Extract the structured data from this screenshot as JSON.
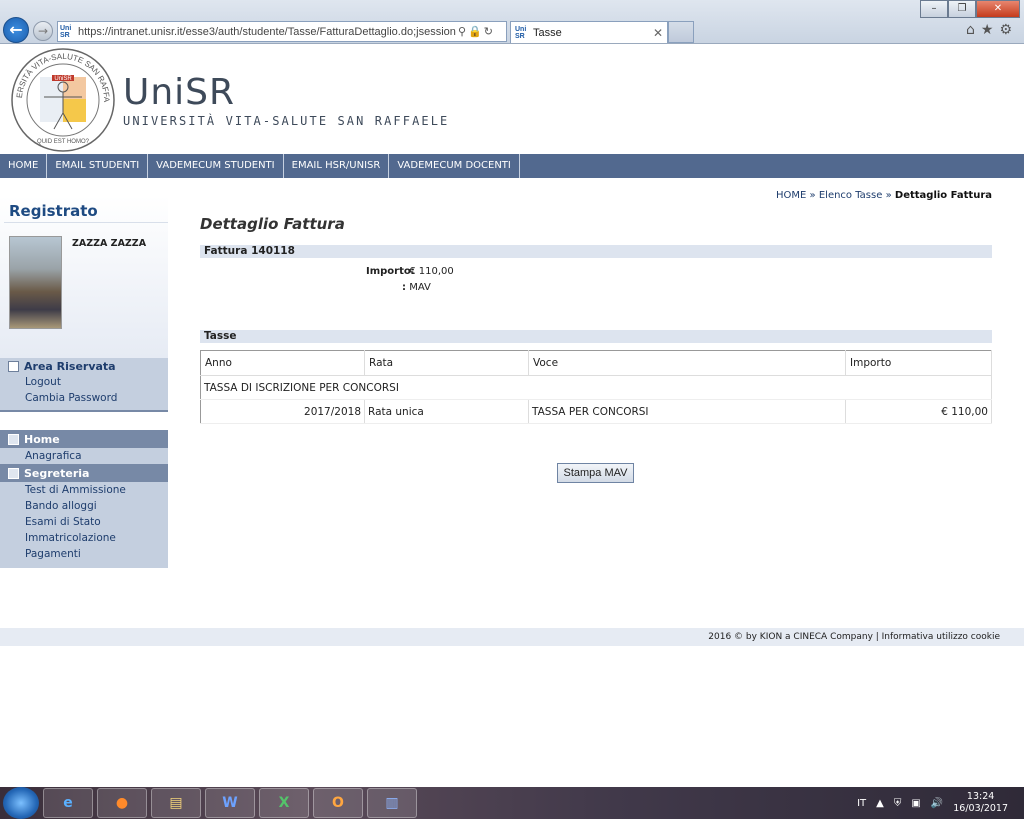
{
  "browser": {
    "url": "https://intranet.unisr.it/esse3/auth/studente/Tasse/FatturaDettaglio.do;jsessionid=12EB9",
    "tab_title": "Tasse"
  },
  "brand": {
    "name": "UniSR",
    "subtitle": "UNIVERSITÀ VITA-SALUTE SAN RAFFAELE",
    "seal_top": "UNIVERSITÀ VITA-SALUTE SAN RAFFAELE",
    "seal_center": "UniSR",
    "seal_bottom": "QUID EST HOMO?"
  },
  "topnav": [
    "HOME",
    "EMAIL STUDENTI",
    "VADEMECUM STUDENTI",
    "EMAIL HSR/UNISR",
    "VADEMECUM DOCENTI"
  ],
  "sidebar": {
    "heading": "Registrato",
    "username": "ZAZZA ZAZZA",
    "area_riservata": {
      "label": "Area Riservata",
      "items": [
        "Logout",
        "Cambia Password"
      ]
    },
    "home": {
      "label": "Home",
      "items": [
        "Anagrafica"
      ]
    },
    "segreteria": {
      "label": "Segreteria",
      "items": [
        "Test di Ammissione",
        "Bando alloggi",
        "Esami di Stato",
        "Immatricolazione",
        "Pagamenti"
      ]
    }
  },
  "breadcrumb": {
    "home": "HOME",
    "sep": "»",
    "elenco": "Elenco Tasse",
    "current": "Dettaglio Fattura"
  },
  "page_title": "Dettaglio Fattura",
  "fattura": {
    "bar_label": "Fattura 140118",
    "importo_label": "Importo:",
    "importo_value": "€ 110,00",
    "second_label": ":",
    "second_value": "MAV"
  },
  "tasse": {
    "bar_label": "Tasse",
    "columns": [
      "Anno",
      "Rata",
      "Voce",
      "Importo"
    ],
    "group": "TASSA DI ISCRIZIONE PER CONCORSI",
    "row": {
      "anno": "2017/2018",
      "rata": "Rata unica",
      "voce": "TASSA PER CONCORSI",
      "importo": "€ 110,00"
    }
  },
  "button_label": "Stampa MAV",
  "footer": "2016 © by KION a CINECA Company | Informativa utilizzo cookie",
  "taskbar": {
    "lang": "IT",
    "time": "13:24",
    "date": "16/03/2017"
  }
}
